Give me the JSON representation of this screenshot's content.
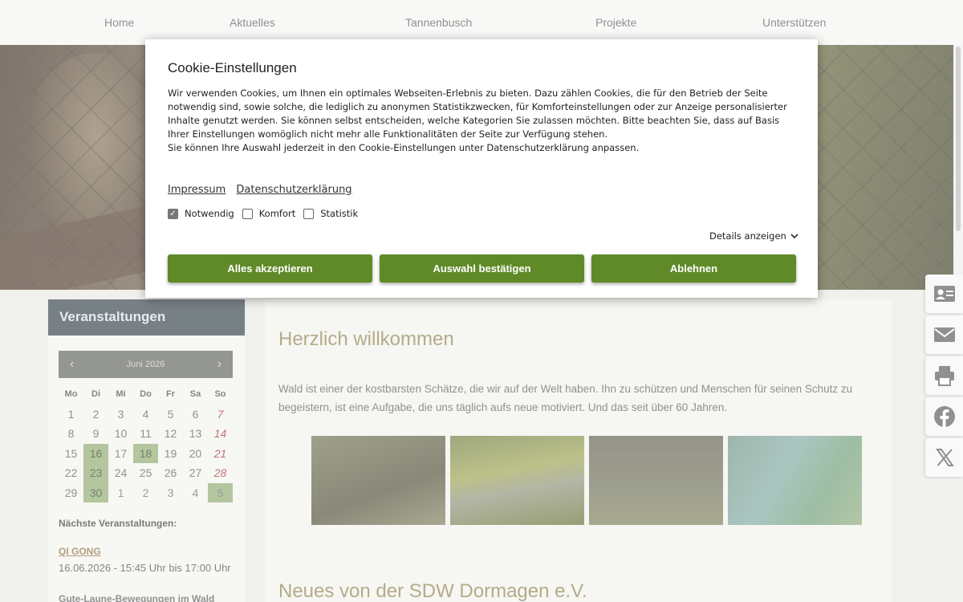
{
  "nav": {
    "items": [
      "Home",
      "Aktuelles",
      "Tannenbusch",
      "Projekte",
      "Unterstützen"
    ]
  },
  "sidebar": {
    "title": "Veranstaltungen",
    "calendar": {
      "prev": "‹",
      "next": "›",
      "month": "Juni 2026",
      "weekdays": [
        "Mo",
        "Di",
        "Mi",
        "Do",
        "Fr",
        "Sa",
        "So"
      ],
      "weeks": [
        [
          "1",
          "2",
          "3",
          "4",
          "5",
          "6",
          "7"
        ],
        [
          "8",
          "9",
          "10",
          "11",
          "12",
          "13",
          "14"
        ],
        [
          "15",
          "16",
          "17",
          "18",
          "19",
          "20",
          "21"
        ],
        [
          "22",
          "23",
          "24",
          "25",
          "26",
          "27",
          "28"
        ],
        [
          "29",
          "30",
          "1",
          "2",
          "3",
          "4",
          "5"
        ]
      ],
      "event_days": [
        "16",
        "18",
        "23",
        "30",
        "5"
      ]
    },
    "next_events_title": "Nächste Veranstaltungen:",
    "event": {
      "name": "QI GONG",
      "time": "16.06.2026 - 15:45 Uhr bis 17:00 Uhr"
    },
    "next_event_cut": "Gute-Laune-Bewegungen im Wald"
  },
  "main": {
    "welcome": "Herzlich willkommen",
    "intro": " Wald ist einer der kostbarsten Schätze, die wir auf der Welt haben. Ihn zu schützen und Menschen für seinen Schutz zu begeistern, ist eine Aufgabe, die uns täglich aufs neue motiviert. Und das seit über 60 Jahren.",
    "news_title": "Neues von der SDW Dormagen e.V."
  },
  "side_tabs": [
    "contact-card-icon",
    "mail-icon",
    "print-icon",
    "facebook-icon",
    "x-icon"
  ],
  "cookie": {
    "title": "Cookie-Einstellungen",
    "text": "Wir verwenden Cookies, um Ihnen ein optimales Webseiten-Erlebnis zu bieten. Dazu zählen Cookies, die für den Betrieb der Seite notwendig sind, sowie solche, die lediglich zu anonymen Statistikzwecken, für Komforteinstellungen oder zur Anzeige personalisierter Inhalte genutzt werden. Sie können selbst entscheiden, welche Kategorien Sie zulassen möchten. Bitte beachten Sie, dass auf Basis Ihrer Einstellungen womöglich nicht mehr alle Funktionalitäten der Seite zur Verfügung stehen.",
    "text2": "Sie können Ihre Auswahl jederzeit in den Cookie-Einstellungen unter Datenschutzerklärung anpassen.",
    "links": {
      "impressum": "Impressum",
      "datenschutz": "Datenschutzerklärung"
    },
    "checks": {
      "notwendig": "Notwendig",
      "komfort": "Komfort",
      "statistik": "Statistik"
    },
    "details": "Details anzeigen",
    "buttons": {
      "accept_all": "Alles akzeptieren",
      "confirm": "Auswahl bestätigen",
      "decline": "Ablehnen"
    },
    "accent": "#5f8a27"
  }
}
